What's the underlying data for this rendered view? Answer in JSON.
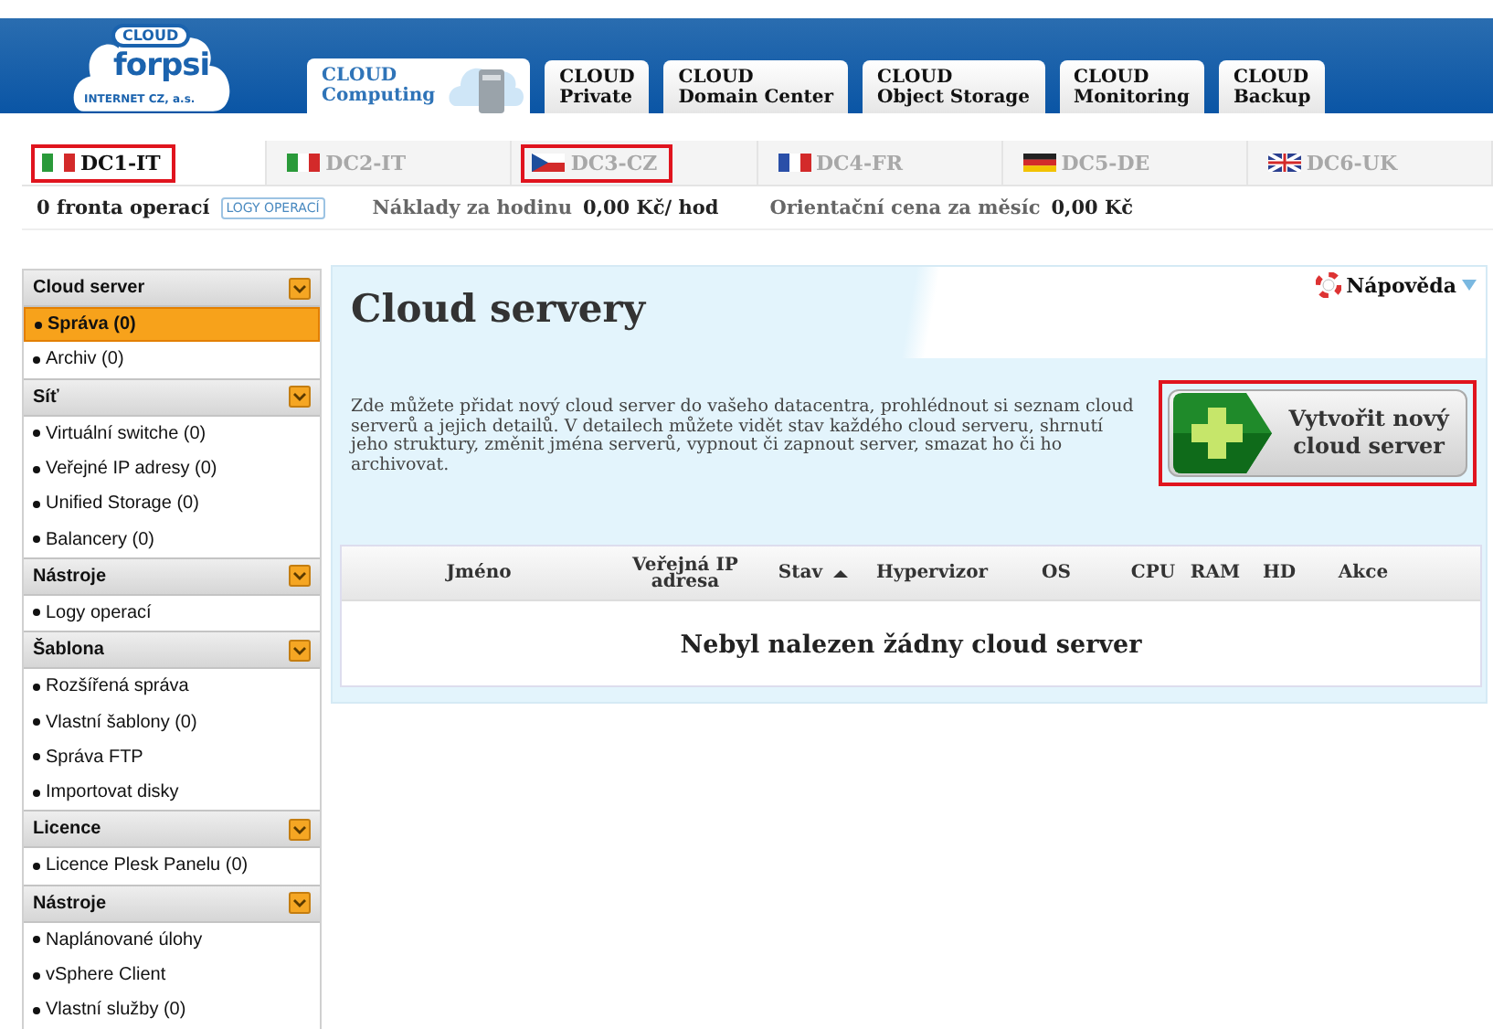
{
  "logo": {
    "badge": "CLOUD",
    "name": "forpsi",
    "subtitle": "INTERNET CZ, a.s."
  },
  "product_tabs": [
    {
      "line1": "CLOUD",
      "line2": "Computing",
      "selected": true
    },
    {
      "line1": "CLOUD",
      "line2": "Private",
      "selected": false
    },
    {
      "line1": "CLOUD",
      "line2": "Domain Center",
      "selected": false
    },
    {
      "line1": "CLOUD",
      "line2": "Object Storage",
      "selected": false
    },
    {
      "line1": "CLOUD",
      "line2": "Monitoring",
      "selected": false
    },
    {
      "line1": "CLOUD",
      "line2": "Backup",
      "selected": false
    }
  ],
  "dc_tabs": [
    {
      "label": "DC1-IT",
      "kind": "it",
      "selected": true,
      "highlighted": true
    },
    {
      "label": "DC2-IT",
      "kind": "it",
      "selected": false,
      "highlighted": false
    },
    {
      "label": "DC3-CZ",
      "kind": "cz",
      "selected": false,
      "highlighted": true
    },
    {
      "label": "DC4-FR",
      "kind": "fr",
      "selected": false,
      "highlighted": false
    },
    {
      "label": "DC5-DE",
      "kind": "de",
      "selected": false,
      "highlighted": false
    },
    {
      "label": "DC6-UK",
      "kind": "uk",
      "selected": false,
      "highlighted": false
    }
  ],
  "info_bar": {
    "queue": "0 fronta operací",
    "logs_button": "LOGY OPERACÍ",
    "hourly_label": "Náklady za hodinu",
    "hourly_value": "0,00 Kč/ hod",
    "monthly_label": "Orientační cena za měsíc",
    "monthly_value": "0,00 Kč"
  },
  "sidebar": [
    {
      "title": "Cloud server",
      "items": [
        {
          "label": "Správa (0)",
          "selected": true
        },
        {
          "label": "Archiv (0)",
          "selected": false
        }
      ]
    },
    {
      "title": "Síť",
      "items": [
        {
          "label": "Virtuální switche (0)",
          "selected": false
        },
        {
          "label": "Veřejné IP adresy (0)",
          "selected": false
        },
        {
          "label": "Unified Storage (0)",
          "selected": false
        },
        {
          "label": "Balancery (0)",
          "selected": false
        }
      ]
    },
    {
      "title": "Nástroje",
      "items": [
        {
          "label": "Logy operací",
          "selected": false
        }
      ]
    },
    {
      "title": "Šablona",
      "items": [
        {
          "label": "Rozšířená správa",
          "selected": false
        },
        {
          "label": "Vlastní šablony (0)",
          "selected": false
        },
        {
          "label": "Správa FTP",
          "selected": false
        },
        {
          "label": "Importovat disky",
          "selected": false
        }
      ]
    },
    {
      "title": "Licence",
      "items": [
        {
          "label": "Licence Plesk Panelu (0)",
          "selected": false
        }
      ]
    },
    {
      "title": "Nástroje",
      "items": [
        {
          "label": "Naplánované úlohy",
          "selected": false
        },
        {
          "label": "vSphere Client",
          "selected": false
        },
        {
          "label": "Vlastní služby (0)",
          "selected": false
        }
      ]
    }
  ],
  "main": {
    "title": "Cloud servery",
    "help": "Nápověda",
    "description": "Zde můžete přidat nový cloud server do vašeho datacentra, prohlédnout si seznam cloud serverů a jejich detailů. V detailech můžete vidět stav každého cloud serveru, shrnutí jeho struktury, změnit jména serverů, vypnout či zapnout server, smazat ho či ho archivovat.",
    "create_button": {
      "label": "Vytvořit nový cloud server",
      "highlighted": true
    },
    "table": {
      "columns": [
        {
          "label": "Jméno",
          "sorted": false
        },
        {
          "label": "Veřejná IP adresa",
          "sorted": false
        },
        {
          "label": "Stav",
          "sorted": true
        },
        {
          "label": "Hypervizor",
          "sorted": false
        },
        {
          "label": "OS",
          "sorted": false
        },
        {
          "label": "CPU",
          "sorted": false
        },
        {
          "label": "RAM",
          "sorted": false
        },
        {
          "label": "HD",
          "sorted": false
        },
        {
          "label": "Akce",
          "sorted": false
        }
      ],
      "empty_message": "Nebyl nalezen žádny cloud server"
    }
  }
}
